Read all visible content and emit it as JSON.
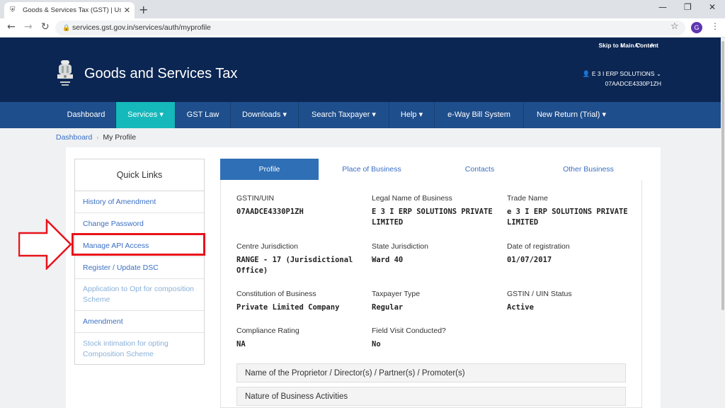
{
  "browser": {
    "tab_title": "Goods & Services Tax (GST) | Use",
    "url": "services.gst.gov.in/services/auth/myprofile",
    "avatar_letter": "G"
  },
  "header": {
    "skip_link": "Skip to Main Content",
    "contrast_icon": "◐",
    "text_increase": "A⁺",
    "text_decrease": "A⁻",
    "site_title": "Goods and Services Tax",
    "user_name": "E 3 I ERP SOLUTIONS",
    "user_gstin": "07AADCE4330P1ZH"
  },
  "nav": {
    "items": [
      {
        "label": "Dashboard"
      },
      {
        "label": "Services ▾"
      },
      {
        "label": "GST Law"
      },
      {
        "label": "Downloads ▾"
      },
      {
        "label": "Search Taxpayer ▾"
      },
      {
        "label": "Help ▾"
      },
      {
        "label": "e-Way Bill System"
      },
      {
        "label": "New Return (Trial) ▾"
      }
    ],
    "active": "Services"
  },
  "breadcrumb": {
    "home": "Dashboard",
    "current": "My Profile"
  },
  "quick_links": {
    "title": "Quick Links",
    "items": [
      {
        "label": "History of Amendment"
      },
      {
        "label": "Change Password"
      },
      {
        "label": "Manage API Access"
      },
      {
        "label": "Register / Update DSC"
      },
      {
        "label": "Application to Opt for composition Scheme"
      },
      {
        "label": "Amendment"
      },
      {
        "label": "Stock intimation for opting Composition Scheme"
      }
    ]
  },
  "profile_tabs": {
    "items": [
      {
        "label": "Profile"
      },
      {
        "label": "Place of Business"
      },
      {
        "label": "Contacts"
      },
      {
        "label": "Other Business"
      }
    ],
    "active": "Profile"
  },
  "profile": {
    "gstin_label": "GSTIN/UIN",
    "gstin_value": "07AADCE4330P1ZH",
    "legal_name_label": "Legal Name of Business",
    "legal_name_value": "E 3 I ERP SOLUTIONS PRIVATE LIMITED",
    "trade_name_label": "Trade Name",
    "trade_name_value": "e 3 I ERP SOLUTIONS PRIVATE LIMITED",
    "centre_label": "Centre Jurisdiction",
    "centre_value": "RANGE - 17 (Jurisdictional Office)",
    "state_label": "State Jurisdiction",
    "state_value": "Ward 40",
    "date_label": "Date of registration",
    "date_value": "01/07/2017",
    "constitution_label": "Constitution of Business",
    "constitution_value": "Private Limited Company",
    "taxpayer_type_label": "Taxpayer Type",
    "taxpayer_type_value": "Regular",
    "status_label": "GSTIN / UIN Status",
    "status_value": "Active",
    "compliance_label": "Compliance Rating",
    "compliance_value": "NA",
    "visit_label": "Field Visit Conducted?",
    "visit_value": "No"
  },
  "accordions": [
    {
      "label": "Name of the Proprietor / Director(s) / Partner(s) / Promoter(s)"
    },
    {
      "label": "Nature of Business Activities"
    }
  ],
  "colors": {
    "header_bg": "#0b2653",
    "nav_bg": "#1f4e8c",
    "nav_active": "#15b8bb",
    "tab_active": "#2f6fb5",
    "link": "#3a6fc4",
    "highlight": "#e8131b"
  }
}
